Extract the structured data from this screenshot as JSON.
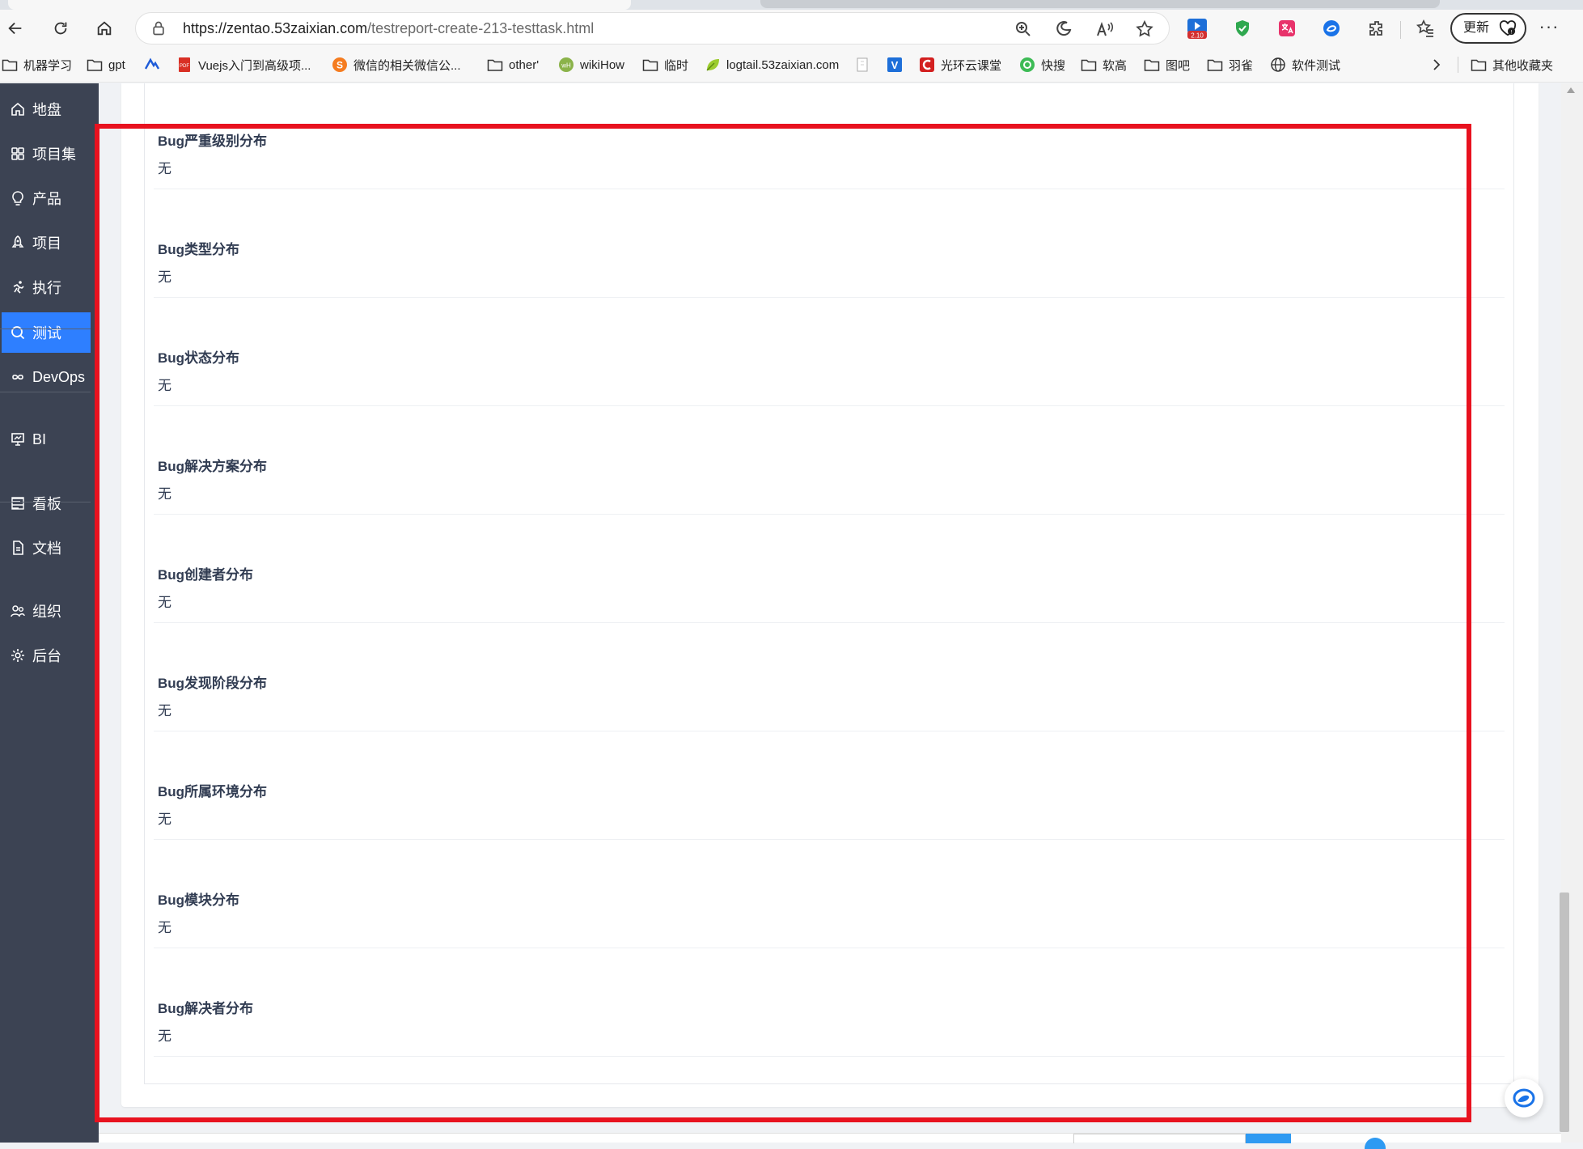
{
  "browser": {
    "url_host": "https://zentao.53zaixian.com",
    "url_path": "/testreport-create-213-testtask.html",
    "update_label": "更新",
    "more_label": "···",
    "ext_badge": "2.10"
  },
  "bookmarks": [
    {
      "label": "机器学习",
      "icon": "folder-icon"
    },
    {
      "label": "gpt",
      "icon": "folder-icon"
    },
    {
      "label": "",
      "icon": "nuxt-icon"
    },
    {
      "label": "Vuejs入门到高级项...",
      "icon": "pdf-icon"
    },
    {
      "label": "微信的相关微信公...",
      "icon": "s-logo-icon"
    },
    {
      "label": "other'",
      "icon": "folder-icon"
    },
    {
      "label": "wikiHow",
      "icon": "wikihow-icon"
    },
    {
      "label": "临时",
      "icon": "folder-icon"
    },
    {
      "label": "logtail.53zaixian.com",
      "icon": "leaf-icon"
    },
    {
      "label": "",
      "icon": "page-icon"
    },
    {
      "label": "",
      "icon": "v-logo-icon"
    },
    {
      "label": "光环云课堂",
      "icon": "red-logo-icon"
    },
    {
      "label": "快搜",
      "icon": "green-circle-icon"
    },
    {
      "label": "软高",
      "icon": "folder-icon"
    },
    {
      "label": "图吧",
      "icon": "folder-icon"
    },
    {
      "label": "羽雀",
      "icon": "folder-icon"
    },
    {
      "label": "软件测试",
      "icon": "globe-icon"
    },
    {
      "label": "其他收藏夹",
      "icon": "folder-icon"
    }
  ],
  "sidebar": {
    "items": [
      {
        "label": "地盘",
        "icon": "home-icon",
        "active": false
      },
      {
        "label": "项目集",
        "icon": "grid-icon",
        "active": false
      },
      {
        "label": "产品",
        "icon": "bulb-icon",
        "active": false
      },
      {
        "label": "项目",
        "icon": "rocket-icon",
        "active": false
      },
      {
        "label": "执行",
        "icon": "run-icon",
        "active": false
      },
      {
        "label": "测试",
        "icon": "search-icon",
        "active": true
      },
      {
        "label": "DevOps",
        "icon": "infinity-icon",
        "active": false
      },
      {
        "label": "BI",
        "icon": "presentation-icon",
        "active": false
      },
      {
        "label": "看板",
        "icon": "kanban-icon",
        "active": false
      },
      {
        "label": "文档",
        "icon": "document-icon",
        "active": false
      },
      {
        "label": "组织",
        "icon": "people-icon",
        "active": false
      },
      {
        "label": "后台",
        "icon": "gear-icon",
        "active": false
      }
    ]
  },
  "report": {
    "sections": [
      {
        "title": "Bug严重级别分布",
        "value": "无"
      },
      {
        "title": "Bug类型分布",
        "value": "无"
      },
      {
        "title": "Bug状态分布",
        "value": "无"
      },
      {
        "title": "Bug解决方案分布",
        "value": "无"
      },
      {
        "title": "Bug创建者分布",
        "value": "无"
      },
      {
        "title": "Bug发现阶段分布",
        "value": "无"
      },
      {
        "title": "Bug所属环境分布",
        "value": "无"
      },
      {
        "title": "Bug模块分布",
        "value": "无"
      },
      {
        "title": "Bug解决者分布",
        "value": "无"
      }
    ]
  },
  "colors": {
    "sidebar_bg": "#3c4353",
    "active_nav": "#2e7fff",
    "annotation": "#e8121f"
  }
}
